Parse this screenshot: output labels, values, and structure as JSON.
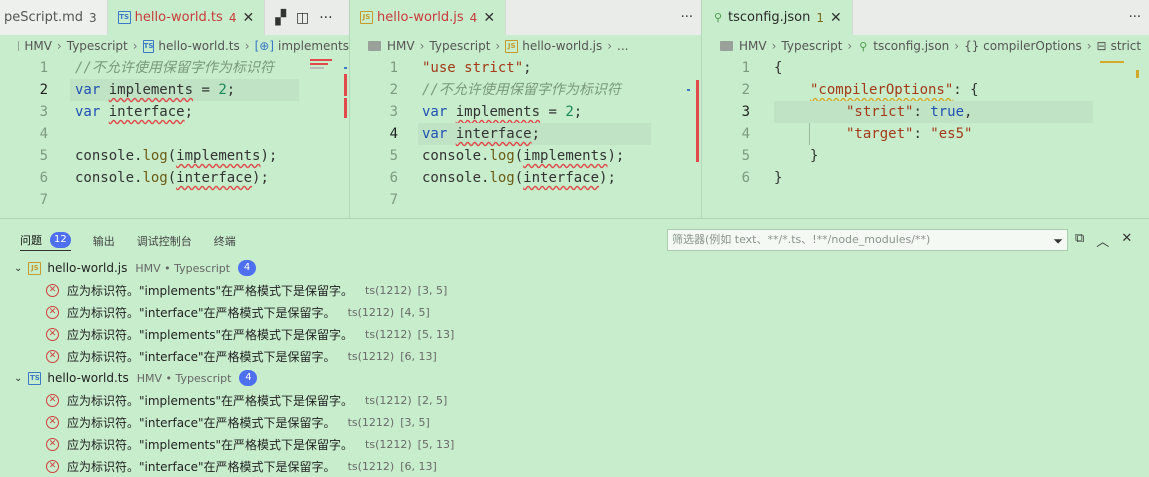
{
  "editor1": {
    "tabs": [
      {
        "label": "peScript.md",
        "count": "3",
        "icon": "markdown-icon",
        "active": false
      },
      {
        "label": "hello-world.ts",
        "count": "4",
        "icon": "ts-icon",
        "active": true
      }
    ],
    "crumbs": [
      "HMV",
      "Typescript",
      "hello-world.ts",
      "implements"
    ],
    "lines": [
      {
        "n": "1"
      },
      {
        "n": "2"
      },
      {
        "n": "3"
      },
      {
        "n": "4"
      },
      {
        "n": "5"
      },
      {
        "n": "6"
      },
      {
        "n": "7"
      }
    ],
    "code": {
      "l1": "//不允许使用保留字作为标识符",
      "l2a": "var",
      "l2b": "implements",
      "l2c": " = ",
      "l2d": "2",
      "l2e": ";",
      "l3a": "var",
      "l3b": "interface",
      "l3c": ";",
      "l5a": "console.",
      "l5b": "log",
      "l5c": "(",
      "l5d": "implements",
      "l5e": ");",
      "l6a": "console.",
      "l6b": "log",
      "l6c": "(",
      "l6d": "interface",
      "l6e": ");"
    }
  },
  "editor2": {
    "tabs": [
      {
        "label": "hello-world.js",
        "count": "4",
        "icon": "js-icon",
        "active": true
      }
    ],
    "crumbs": [
      "HMV",
      "Typescript",
      "hello-world.js",
      "..."
    ],
    "lines": [
      {
        "n": "1"
      },
      {
        "n": "2"
      },
      {
        "n": "3"
      },
      {
        "n": "4"
      },
      {
        "n": "5"
      },
      {
        "n": "6"
      },
      {
        "n": "7"
      }
    ],
    "code": {
      "l1": "\"use strict\"",
      "l1b": ";",
      "l2": "//不允许使用保留字作为标识符",
      "l3a": "var",
      "l3b": "implements",
      "l3c": " = ",
      "l3d": "2",
      "l3e": ";",
      "l4a": "var",
      "l4b": "interface",
      "l4c": ";",
      "l5a": "console.",
      "l5b": "log",
      "l5c": "(",
      "l5d": "implements",
      "l5e": ");",
      "l6a": "console.",
      "l6b": "log",
      "l6c": "(",
      "l6d": "interface",
      "l6e": ");"
    }
  },
  "editor3": {
    "tabs": [
      {
        "label": "tsconfig.json",
        "count": "1",
        "icon": "json-icon",
        "active": true
      }
    ],
    "crumbs": [
      "HMV",
      "Typescript",
      "tsconfig.json",
      "{} compilerOptions",
      "strict"
    ],
    "lines": [
      {
        "n": "1"
      },
      {
        "n": "2"
      },
      {
        "n": "3"
      },
      {
        "n": "4"
      },
      {
        "n": "5"
      },
      {
        "n": "6"
      }
    ],
    "code": {
      "l1": "{",
      "l2a": "\"compilerOptions\"",
      "l2b": ": {",
      "l3a": "\"strict\"",
      "l3b": ": ",
      "l3c": "true",
      "l3d": ",",
      "l4a": "\"target\"",
      "l4b": ": ",
      "l4c": "\"es5\"",
      "l5": "}",
      "l6": "}"
    }
  },
  "panel": {
    "tabs": [
      {
        "label": "问题",
        "badge": "12",
        "active": true
      },
      {
        "label": "输出"
      },
      {
        "label": "调试控制台"
      },
      {
        "label": "终端"
      }
    ],
    "filter_placeholder": "筛选器(例如 text、**/*.ts、!**/node_modules/**)",
    "groups": [
      {
        "file": "hello-world.js",
        "path": "HMV • Typescript",
        "count": "4",
        "icon": "js-icon",
        "items": [
          {
            "msg": "应为标识符。\"implements\"在严格模式下是保留字。",
            "src": "ts(1212)",
            "pos": "[3, 5]"
          },
          {
            "msg": "应为标识符。\"interface\"在严格模式下是保留字。",
            "src": "ts(1212)",
            "pos": "[4, 5]"
          },
          {
            "msg": "应为标识符。\"implements\"在严格模式下是保留字。",
            "src": "ts(1212)",
            "pos": "[5, 13]"
          },
          {
            "msg": "应为标识符。\"interface\"在严格模式下是保留字。",
            "src": "ts(1212)",
            "pos": "[6, 13]"
          }
        ]
      },
      {
        "file": "hello-world.ts",
        "path": "HMV • Typescript",
        "count": "4",
        "icon": "ts-icon",
        "items": [
          {
            "msg": "应为标识符。\"implements\"在严格模式下是保留字。",
            "src": "ts(1212)",
            "pos": "[2, 5]"
          },
          {
            "msg": "应为标识符。\"interface\"在严格模式下是保留字。",
            "src": "ts(1212)",
            "pos": "[3, 5]"
          },
          {
            "msg": "应为标识符。\"implements\"在严格模式下是保留字。",
            "src": "ts(1212)",
            "pos": "[5, 13]"
          },
          {
            "msg": "应为标识符。\"interface\"在严格模式下是保留字。",
            "src": "ts(1212)",
            "pos": "[6, 13]"
          }
        ]
      }
    ]
  },
  "colors": {
    "background": "#c7edcc",
    "error": "#e04a4a",
    "badge": "#4e6ff0"
  }
}
